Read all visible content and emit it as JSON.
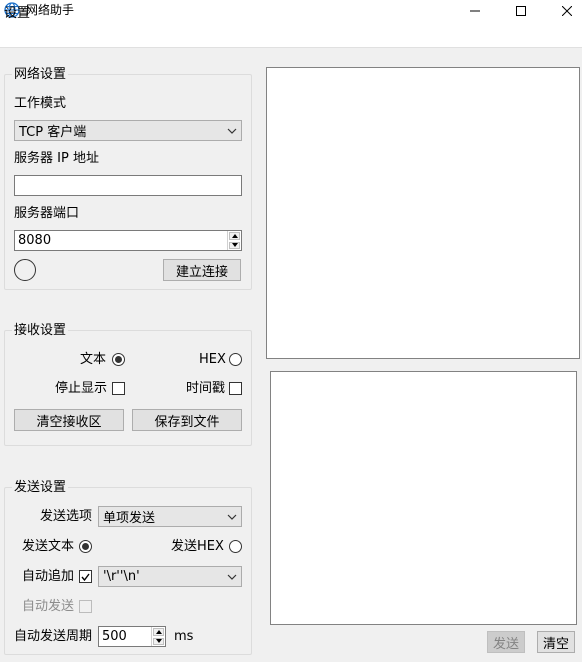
{
  "window": {
    "title": "网络助手"
  },
  "menu": {
    "settings": "设置"
  },
  "network": {
    "group_title": "网络设置",
    "mode_label": "工作模式",
    "mode_value": "TCP 客户端",
    "server_ip_label": "服务器 IP 地址",
    "server_ip_value": "",
    "server_port_label": "服务器端口",
    "server_port_value": "8080",
    "connect_button": "建立连接"
  },
  "receive": {
    "group_title": "接收设置",
    "text_label": "文本",
    "hex_label": "HEX",
    "stop_display_label": "停止显示",
    "timestamp_label": "时间戳",
    "clear_button": "清空接收区",
    "save_button": "保存到文件"
  },
  "send": {
    "group_title": "发送设置",
    "options_label": "发送选项",
    "options_value": "单项发送",
    "send_text_label": "发送文本",
    "send_hex_label": "发送HEX",
    "auto_append_label": "自动追加",
    "auto_append_value": "'\\r''\\n'",
    "auto_send_label": "自动发送",
    "period_label": "自动发送周期",
    "period_value": "500",
    "period_unit": "ms"
  },
  "actions": {
    "send_button": "发送",
    "clear_button": "清空"
  }
}
